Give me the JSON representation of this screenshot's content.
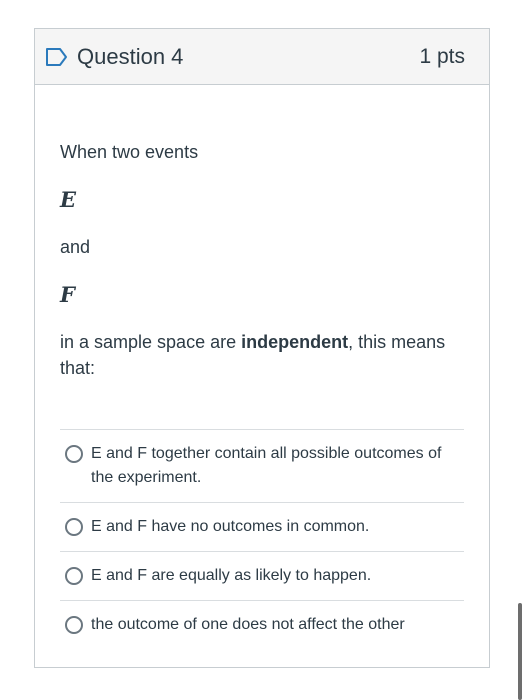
{
  "question": {
    "title": "Question 4",
    "points": "1 pts",
    "prompt_lines": [
      "When two events",
      "and",
      "in a sample space are"
    ],
    "variables": [
      "E",
      "F"
    ],
    "keyword": "independent",
    "prompt_tail": ", this means that:"
  },
  "answers": [
    {
      "label": "E and F together contain all possible outcomes of the experiment."
    },
    {
      "label": "E and F have no outcomes in common."
    },
    {
      "label": "E and F are equally as likely to happen."
    },
    {
      "label": "the outcome of one does not affect the other"
    }
  ],
  "colors": {
    "border": "#c7cdd1",
    "header_bg": "#f5f5f5",
    "text": "#2d3b45",
    "flag": "#2b7abc"
  },
  "icons": {
    "flag": "flag-icon",
    "radio": "radio-icon"
  }
}
